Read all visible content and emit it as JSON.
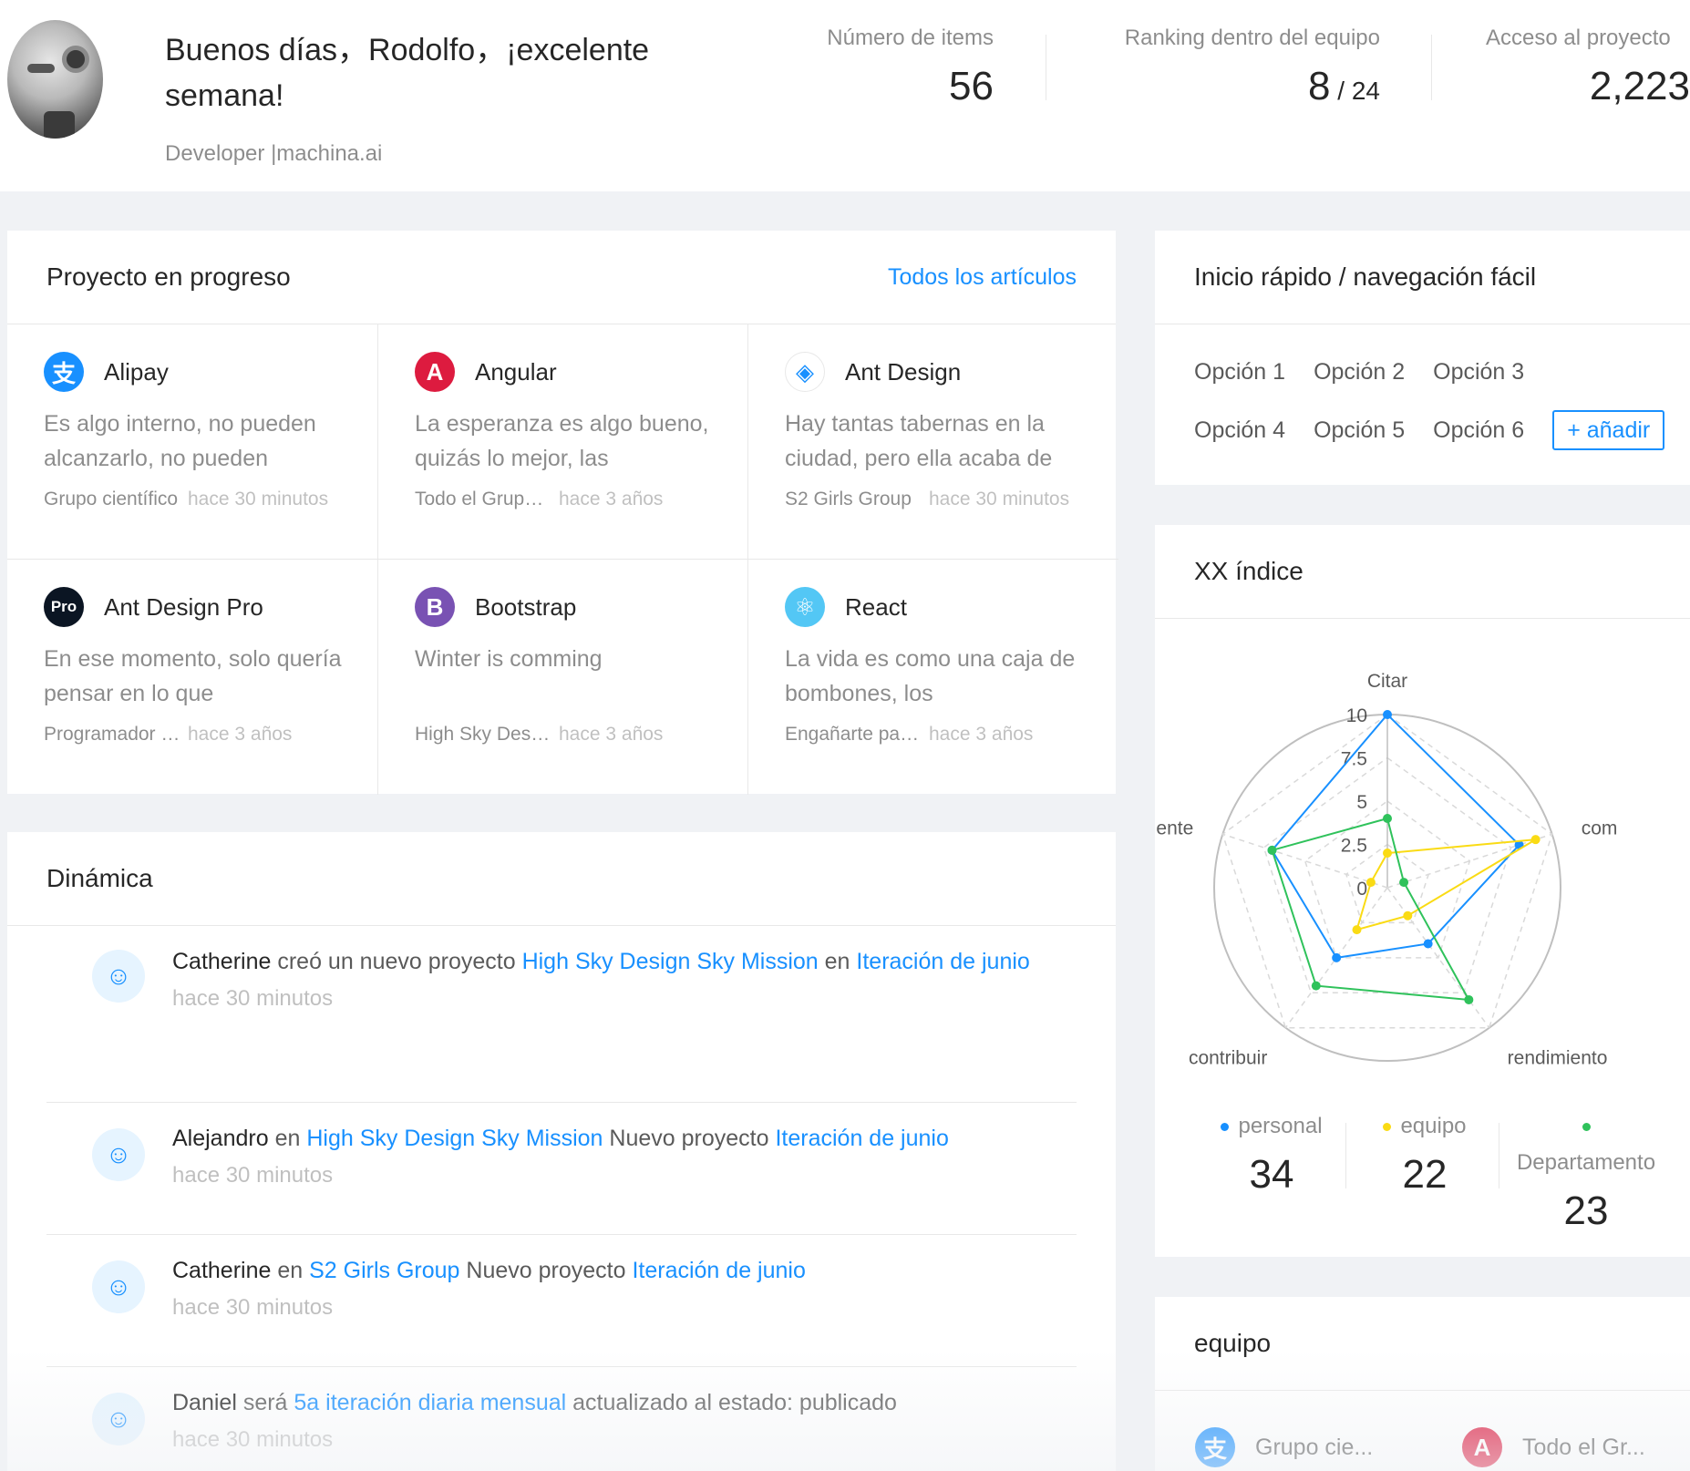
{
  "header": {
    "greeting": "Buenos días，Rodolfo，¡excelente semana!",
    "role": "Developer |machina.ai",
    "stats": [
      {
        "label": "Número de items",
        "value": "56",
        "suffix": ""
      },
      {
        "label": "Ranking dentro del equipo",
        "value": "8",
        "suffix": " / 24"
      },
      {
        "label": "Acceso al proyecto",
        "value": "2,223",
        "suffix": ""
      }
    ]
  },
  "projects": {
    "title": "Proyecto en progreso",
    "extra": "Todos los artículos",
    "items": [
      {
        "name": "Alipay",
        "logo": "支",
        "logo_color": "#1890ff",
        "desc": "Es algo interno, no pueden alcanzarlo, no pueden",
        "group": "Grupo científico",
        "time": "hace 30 minutos"
      },
      {
        "name": "Angular",
        "logo": "A",
        "logo_color": "#dd1b3f",
        "desc": "La esperanza es algo bueno, quizás lo mejor, las",
        "group": "Todo el Grupo es",
        "time": "hace 3 años"
      },
      {
        "name": "Ant Design",
        "logo": "◈",
        "logo_color": "#ffffff",
        "desc": "Hay tantas tabernas en la ciudad, pero ella acaba de",
        "group": "S2 Girls Group",
        "time": "hace 30 minutos"
      },
      {
        "name": "Ant Design Pro",
        "logo": "Pro",
        "logo_color": "#0b1523",
        "desc": "En ese momento, solo quería pensar en lo que",
        "group": "Programador diario",
        "time": "hace 3 años"
      },
      {
        "name": "Bootstrap",
        "logo": "B",
        "logo_color": "#7952b3",
        "desc": "Winter is comming",
        "group": "High Sky Design",
        "time": "hace 3 años"
      },
      {
        "name": "React",
        "logo": "⚛",
        "logo_color": "#53c7f5",
        "desc": "La vida es como una caja de bombones, los",
        "group": "Engañarte para a",
        "time": "hace 3 años"
      }
    ]
  },
  "activity": {
    "title": "Dinámica",
    "items": [
      {
        "user": "Catherine",
        "t1": " creó un nuevo proyecto ",
        "link1": "High Sky Design Sky Mission",
        "t2": " en ",
        "link2": "Iteración de junio",
        "time": "hace 30 minutos"
      },
      {
        "user": "Alejandro",
        "t1": " en ",
        "link1": "High Sky Design Sky Mission",
        "t2": " Nuevo proyecto ",
        "link2": "Iteración de junio",
        "time": "hace 30 minutos"
      },
      {
        "user": "Catherine",
        "t1": " en ",
        "link1": "S2 Girls Group",
        "t2": " Nuevo proyecto ",
        "link2": "Iteración de junio",
        "time": "hace 30 minutos"
      },
      {
        "user": "Daniel",
        "t1": " será ",
        "link1": "5a iteración diaria mensual",
        "t2": " actualizado al estado: publicado",
        "link2": "",
        "time": "hace 30 minutos"
      }
    ]
  },
  "quick": {
    "title": "Inicio rápido / navegación fácil",
    "options": [
      "Opción 1",
      "Opción 2",
      "Opción 3",
      "Opción 4",
      "Opción 5",
      "Opción 6"
    ],
    "add_label": "+ añadir"
  },
  "radar": {
    "title": "XX índice",
    "axis_labels": [
      "Citar",
      "com",
      "rendimiento",
      "contribuir",
      "ente"
    ],
    "ticks": [
      "10",
      "7.5",
      "5",
      "2.5",
      "0"
    ],
    "legend": [
      {
        "name": "personal",
        "color": "#1890ff",
        "value": "34"
      },
      {
        "name": "equipo",
        "color": "#fadb14",
        "value": "22"
      },
      {
        "name": "Departamento",
        "color": "#2fc25b",
        "value": "23"
      }
    ]
  },
  "chart_data": {
    "type": "radar",
    "categories": [
      "Citar",
      "com",
      "rendimiento",
      "contribuir",
      "ente"
    ],
    "ylim": [
      0,
      10
    ],
    "series": [
      {
        "name": "personal",
        "values": [
          10,
          8,
          4,
          5,
          7
        ]
      },
      {
        "name": "equipo",
        "values": [
          2,
          9,
          2,
          3,
          1
        ]
      },
      {
        "name": "Departamento",
        "values": [
          4,
          1,
          8,
          7,
          7
        ]
      }
    ]
  },
  "team": {
    "title": "equipo",
    "items": [
      {
        "name": "Grupo cie...",
        "logo": "支",
        "logo_color": "#1890ff"
      },
      {
        "name": "Todo el Gr...",
        "logo": "A",
        "logo_color": "#dd1b3f"
      }
    ]
  }
}
